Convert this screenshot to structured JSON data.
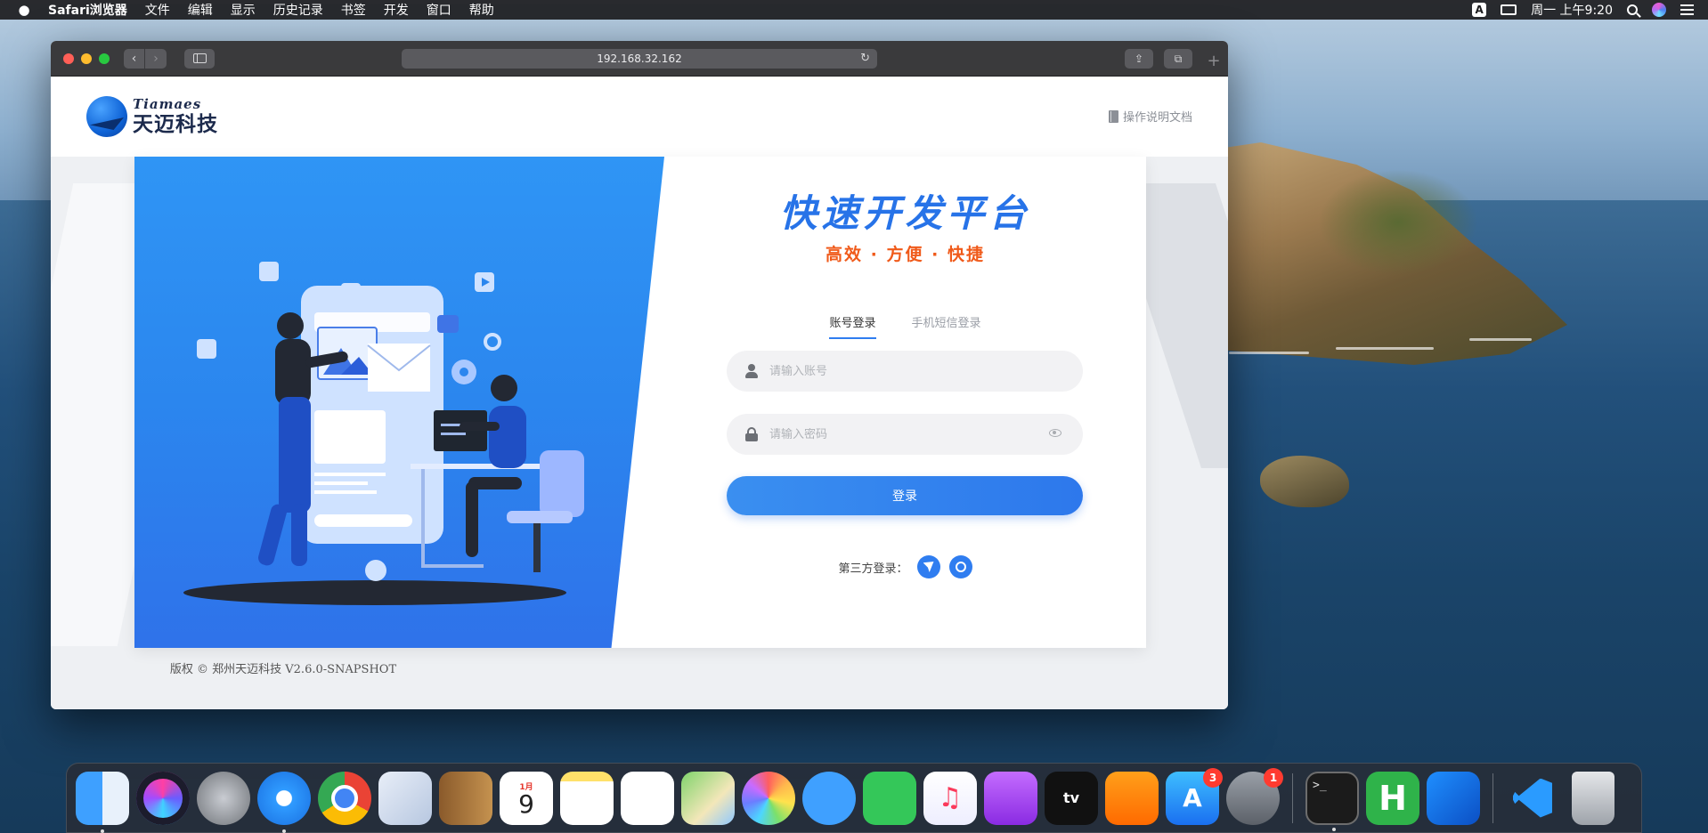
{
  "menubar": {
    "app_name": "Safari浏览器",
    "menus": [
      "文件",
      "编辑",
      "显示",
      "历史记录",
      "书签",
      "开发",
      "窗口",
      "帮助"
    ],
    "input_method": "A",
    "clock": "周一 上午9:20"
  },
  "browser": {
    "url": "192.168.32.162"
  },
  "page": {
    "logo_en": "Tiamaes",
    "logo_cn": "天迈科技",
    "doc_link": "操作说明文档",
    "title": "快速开发平台",
    "subtitle": "高效 · 方便 · 快捷",
    "tabs": [
      "账号登录",
      "手机短信登录"
    ],
    "active_tab": "账号登录",
    "account_placeholder": "请输入账号",
    "password_placeholder": "请输入密码",
    "login_button": "登录",
    "third_party_label": "第三方登录：",
    "copyright": "版权 © 郑州天迈科技 V2.6.0-SNAPSHOT"
  },
  "colors": {
    "brand_blue": "#2f7df0",
    "title_blue": "#2773e8",
    "subtitle_orange": "#f05a1a",
    "hero_blue": "#2b86ee"
  },
  "dock": {
    "items": [
      {
        "name": "finder",
        "badge": "",
        "running": true
      },
      {
        "name": "siri",
        "badge": "",
        "running": false
      },
      {
        "name": "launchpad",
        "badge": "",
        "running": false
      },
      {
        "name": "safari",
        "badge": "",
        "running": true
      },
      {
        "name": "chrome",
        "badge": "",
        "running": false
      },
      {
        "name": "mail",
        "badge": "",
        "running": false
      },
      {
        "name": "contacts",
        "badge": "",
        "running": false
      },
      {
        "name": "calendar",
        "badge": "",
        "running": false
      },
      {
        "name": "notes",
        "badge": "",
        "running": false
      },
      {
        "name": "reminders",
        "badge": "",
        "running": false
      },
      {
        "name": "maps",
        "badge": "",
        "running": false
      },
      {
        "name": "photos",
        "badge": "",
        "running": false
      },
      {
        "name": "messages",
        "badge": "",
        "running": false
      },
      {
        "name": "facetime",
        "badge": "",
        "running": false
      },
      {
        "name": "music",
        "badge": "",
        "running": false
      },
      {
        "name": "podcasts",
        "badge": "",
        "running": false
      },
      {
        "name": "apple-tv",
        "badge": "",
        "running": false
      },
      {
        "name": "books",
        "badge": "",
        "running": false
      },
      {
        "name": "app-store",
        "badge": "3",
        "running": false
      },
      {
        "name": "system-preferences",
        "badge": "1",
        "running": false
      },
      {
        "name": "terminal",
        "badge": "",
        "running": true
      },
      {
        "name": "hbuilder",
        "badge": "",
        "running": false
      },
      {
        "name": "xcode",
        "badge": "",
        "running": false
      },
      {
        "name": "vscode",
        "badge": "",
        "running": false
      },
      {
        "name": "trash",
        "badge": "",
        "running": false
      }
    ],
    "calendar_month": "1月",
    "calendar_day": "9",
    "terminal_prompt": ">_",
    "tv_label": "tv",
    "hbuilder_label": "H",
    "appstore_glyph": "A",
    "music_glyph": "♫"
  }
}
